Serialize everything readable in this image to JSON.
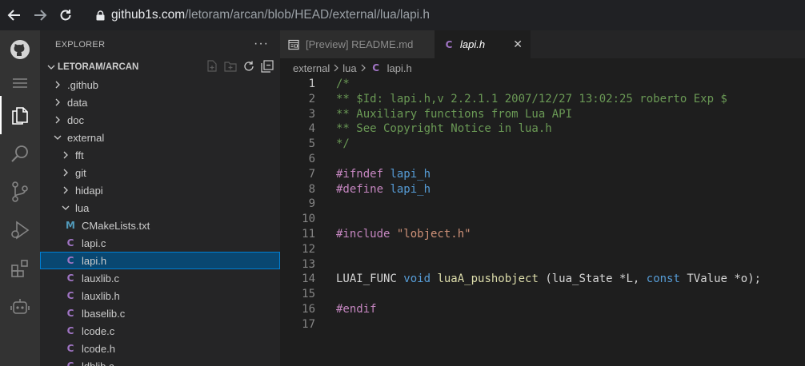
{
  "browser": {
    "url_domain": "github1s.com",
    "url_path": "/letoram/arcan/blob/HEAD/external/lua/lapi.h"
  },
  "activity_bar": {
    "items": [
      "github-icon",
      "menu-icon",
      "files-icon",
      "search-icon",
      "source-control-icon",
      "run-debug-icon",
      "extensions-icon",
      "remote-bot-icon"
    ]
  },
  "sidebar": {
    "title": "EXPLORER",
    "more": "···",
    "repo": "LETORAM/ARCAN",
    "tree": [
      {
        "label": ".github",
        "type": "folder",
        "open": false,
        "depth": 0
      },
      {
        "label": "data",
        "type": "folder",
        "open": false,
        "depth": 0
      },
      {
        "label": "doc",
        "type": "folder",
        "open": false,
        "depth": 0
      },
      {
        "label": "external",
        "type": "folder",
        "open": true,
        "depth": 0
      },
      {
        "label": "fft",
        "type": "folder",
        "open": false,
        "depth": 1
      },
      {
        "label": "git",
        "type": "folder",
        "open": false,
        "depth": 1
      },
      {
        "label": "hidapi",
        "type": "folder",
        "open": false,
        "depth": 1
      },
      {
        "label": "lua",
        "type": "folder",
        "open": true,
        "depth": 1
      },
      {
        "label": "CMakeLists.txt",
        "type": "file",
        "icon": "M",
        "depth": 2
      },
      {
        "label": "lapi.c",
        "type": "file",
        "icon": "C",
        "depth": 2
      },
      {
        "label": "lapi.h",
        "type": "file",
        "icon": "C",
        "depth": 2,
        "selected": true
      },
      {
        "label": "lauxlib.c",
        "type": "file",
        "icon": "C",
        "depth": 2
      },
      {
        "label": "lauxlib.h",
        "type": "file",
        "icon": "C",
        "depth": 2
      },
      {
        "label": "lbaselib.c",
        "type": "file",
        "icon": "C",
        "depth": 2
      },
      {
        "label": "lcode.c",
        "type": "file",
        "icon": "C",
        "depth": 2
      },
      {
        "label": "lcode.h",
        "type": "file",
        "icon": "C",
        "depth": 2
      },
      {
        "label": "ldblib.c",
        "type": "file",
        "icon": "C",
        "depth": 2
      }
    ]
  },
  "tabs": [
    {
      "label": "[Preview] README.md",
      "active": false
    },
    {
      "label": "lapi.h",
      "active": true,
      "icon": "C",
      "close": "✕"
    }
  ],
  "breadcrumb": {
    "part1": "external",
    "part2": "lua",
    "part3": "lapi.h",
    "icon": "C"
  },
  "code": {
    "current_line": 1,
    "lines": [
      [
        {
          "t": "/*",
          "c": "comment"
        }
      ],
      [
        {
          "t": "** $Id: lapi.h,v 2.2.1.1 2007/12/27 13:02:25 roberto Exp $",
          "c": "comment"
        }
      ],
      [
        {
          "t": "** Auxiliary functions from Lua API",
          "c": "comment"
        }
      ],
      [
        {
          "t": "** See Copyright Notice in lua.h",
          "c": "comment"
        }
      ],
      [
        {
          "t": "*/",
          "c": "comment"
        }
      ],
      [],
      [
        {
          "t": "#ifndef ",
          "c": "prep"
        },
        {
          "t": "lapi_h",
          "c": "macro"
        }
      ],
      [
        {
          "t": "#define ",
          "c": "prep"
        },
        {
          "t": "lapi_h",
          "c": "macro"
        }
      ],
      [],
      [],
      [
        {
          "t": "#include ",
          "c": "prep"
        },
        {
          "t": "\"lobject.h\"",
          "c": "str"
        }
      ],
      [],
      [],
      [
        {
          "t": "LUAI_FUNC ",
          "c": "plain"
        },
        {
          "t": "void",
          "c": "kw"
        },
        {
          "t": " ",
          "c": "plain"
        },
        {
          "t": "luaA_pushobject",
          "c": "fn"
        },
        {
          "t": " (",
          "c": "plain"
        },
        {
          "t": "lua_State",
          "c": "plain"
        },
        {
          "t": " *L, ",
          "c": "plain"
        },
        {
          "t": "const",
          "c": "kw"
        },
        {
          "t": " TValue *o);",
          "c": "plain"
        }
      ],
      [],
      [
        {
          "t": "#endif",
          "c": "prep"
        }
      ],
      []
    ]
  }
}
